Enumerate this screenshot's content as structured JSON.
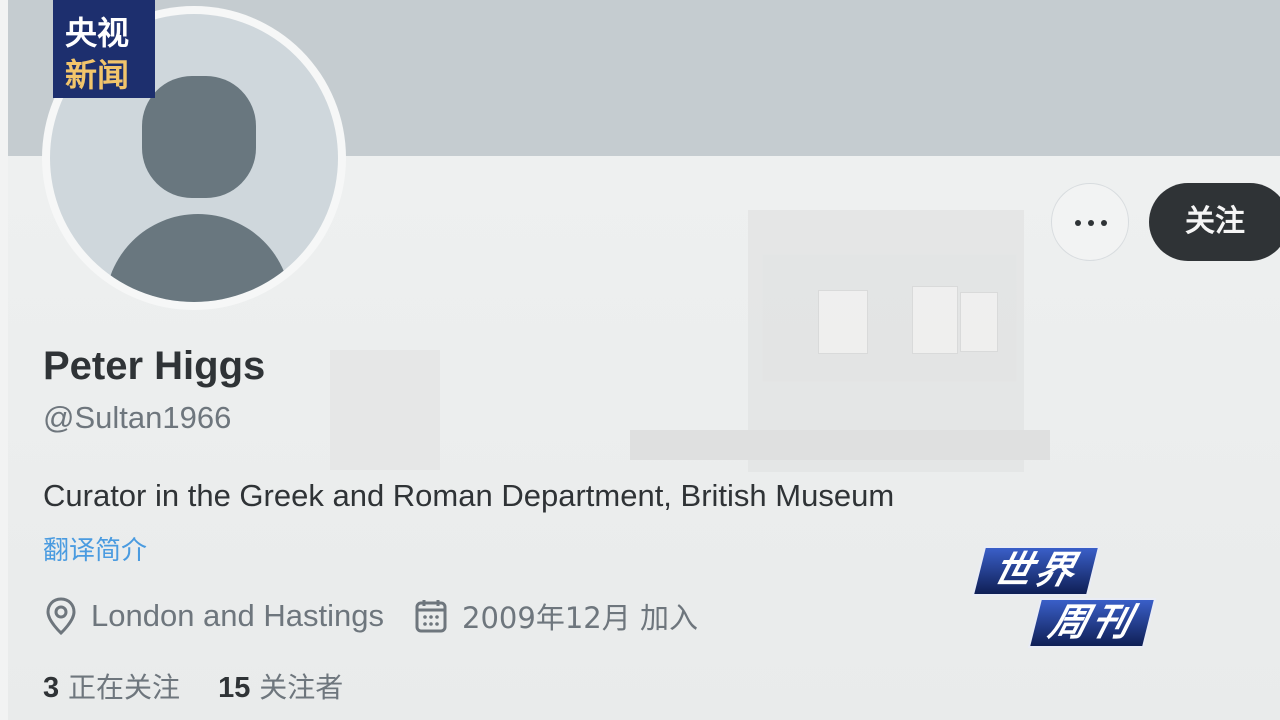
{
  "channel_logo": {
    "line1": "央视",
    "line2": "新闻"
  },
  "profile": {
    "name": "Peter Higgs",
    "handle": "@Sultan1966",
    "bio": "Curator in the Greek and Roman Department, British Museum",
    "translate_label": "翻译简介",
    "location": "London and Hastings",
    "joined": "2009年12月 加入",
    "following_count": "3",
    "following_label": "正在关注",
    "followers_count": "15",
    "followers_label": "关注者"
  },
  "actions": {
    "more_icon": "ellipsis-icon",
    "follow_label": "关注"
  },
  "watermark": {
    "line1": "世界",
    "line2": "周刊"
  },
  "colors": {
    "follow_button": "#2f3336",
    "link": "#4a9be0",
    "banner": "#c5ccd0",
    "avatar_silhouette": "#69777f"
  }
}
